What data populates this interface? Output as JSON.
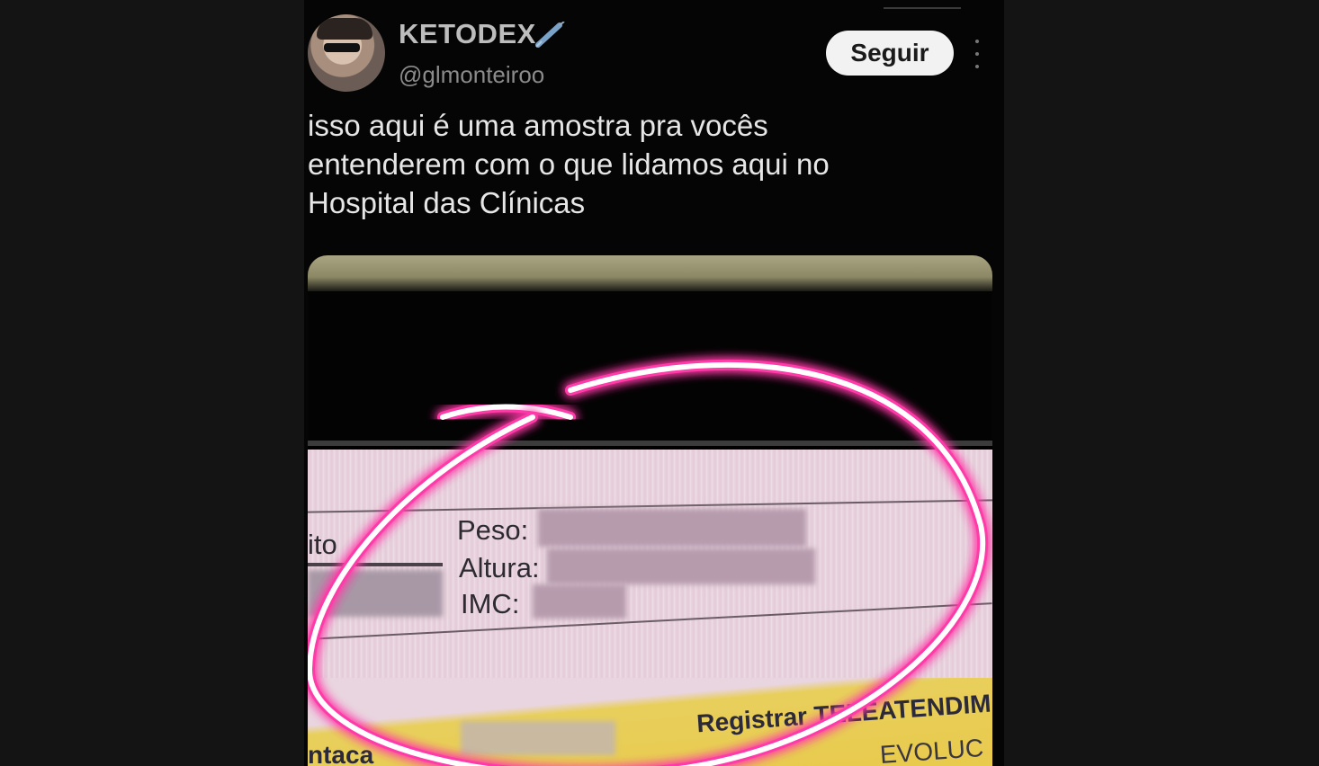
{
  "tweet": {
    "display_name": "KETODEX",
    "handle": "@glmonteiroo",
    "follow_label": "Seguir",
    "text_lines": [
      "isso aqui é uma amostra pra vocês",
      "entenderem com o que lidamos aqui no",
      "Hospital das Clínicas"
    ]
  },
  "media": {
    "left_fragment": "ito",
    "peso_label": "Peso:",
    "altura_label": "Altura:",
    "imc_label": "IMC:",
    "registrar_label": "Registrar TELEATENDIM",
    "bottom_left": "ntaca",
    "bottom_right": "EVOLUC",
    "highlight_color": "#ff3aa8"
  }
}
